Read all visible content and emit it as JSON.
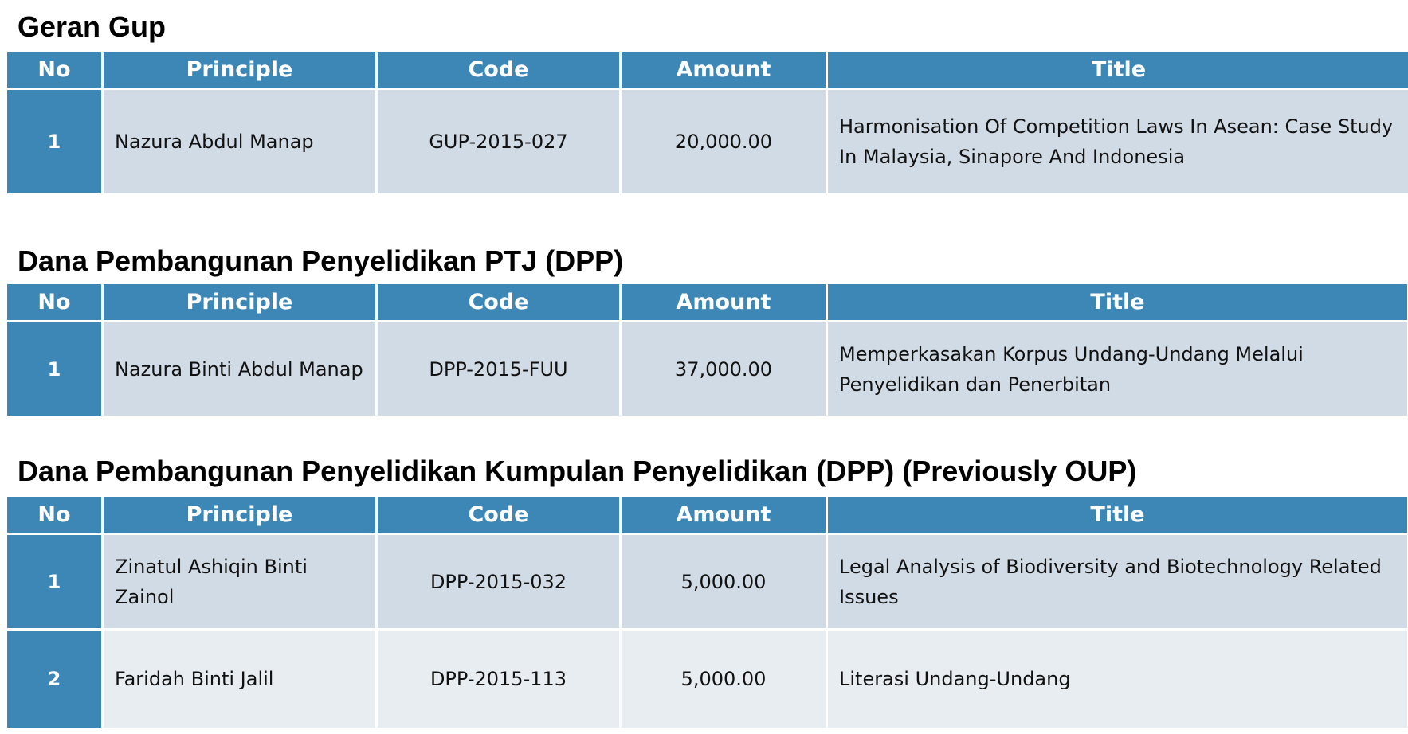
{
  "columns": {
    "no": "No",
    "principle": "Principle",
    "code": "Code",
    "amount": "Amount",
    "title": "Title"
  },
  "colors": {
    "header_bg": "#3d87b6",
    "row_odd": "#d0dbe5",
    "row_even": "#e8edf1"
  },
  "sections": [
    {
      "heading": "Geran Gup",
      "rows": [
        {
          "no": "1",
          "principle": "Nazura Abdul Manap",
          "code": "GUP-2015-027",
          "amount": "20,000.00",
          "title": "Harmonisation Of Competition Laws In Asean: Case Study In Malaysia, Sinapore And Indonesia"
        }
      ]
    },
    {
      "heading": "Dana Pembangunan Penyelidikan PTJ (DPP)",
      "rows": [
        {
          "no": "1",
          "principle": "Nazura Binti Abdul Manap",
          "code": "DPP-2015-FUU",
          "amount": "37,000.00",
          "title": "Memperkasakan Korpus Undang-Undang Melalui Penyelidikan dan Penerbitan"
        }
      ]
    },
    {
      "heading": "Dana Pembangunan Penyelidikan Kumpulan Penyelidikan (DPP) (Previously OUP)",
      "rows": [
        {
          "no": "1",
          "principle": "Zinatul Ashiqin Binti Zainol",
          "code": "DPP-2015-032",
          "amount": "5,000.00",
          "title": "Legal Analysis of Biodiversity and Biotechnology Related Issues"
        },
        {
          "no": "2",
          "principle": "Faridah Binti Jalil",
          "code": "DPP-2015-113",
          "amount": "5,000.00",
          "title": "Literasi Undang-Undang"
        }
      ]
    }
  ]
}
